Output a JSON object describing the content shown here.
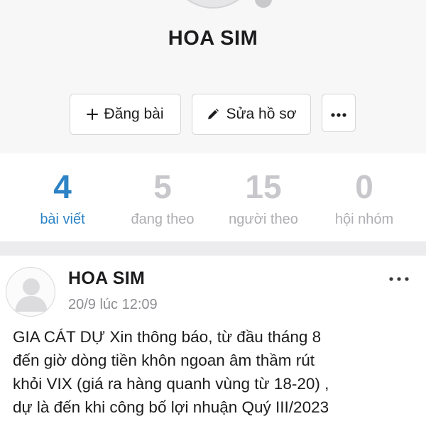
{
  "profile": {
    "name": "HOA SIM"
  },
  "actions": {
    "post_label": "Đăng bài",
    "edit_label": "Sửa hồ sơ",
    "more_icon": "more-horizontal-icon"
  },
  "stats": [
    {
      "count": "4",
      "label": "bài viết",
      "active": true
    },
    {
      "count": "5",
      "label": "đang theo",
      "active": false
    },
    {
      "count": "15",
      "label": "người theo",
      "active": false
    },
    {
      "count": "0",
      "label": "hội nhóm",
      "active": false
    }
  ],
  "post": {
    "author": "HOA SIM",
    "time": "20/9 lúc 12:09",
    "lines": [
      "GIA CÁT DỰ Xin thông báo, từ đầu tháng 8",
      "đến giờ dòng tiền khôn ngoan âm thầm rút",
      "khỏi VIX (giá ra hàng quanh vùng từ 18-20) ,",
      "dự là đến khi công bố lợi nhuận Quý III/2023"
    ]
  },
  "colors": {
    "accent": "#2d83c5",
    "muted": "#c7c7cc",
    "header_bg": "#f7f7f8",
    "divider": "#ececee"
  }
}
